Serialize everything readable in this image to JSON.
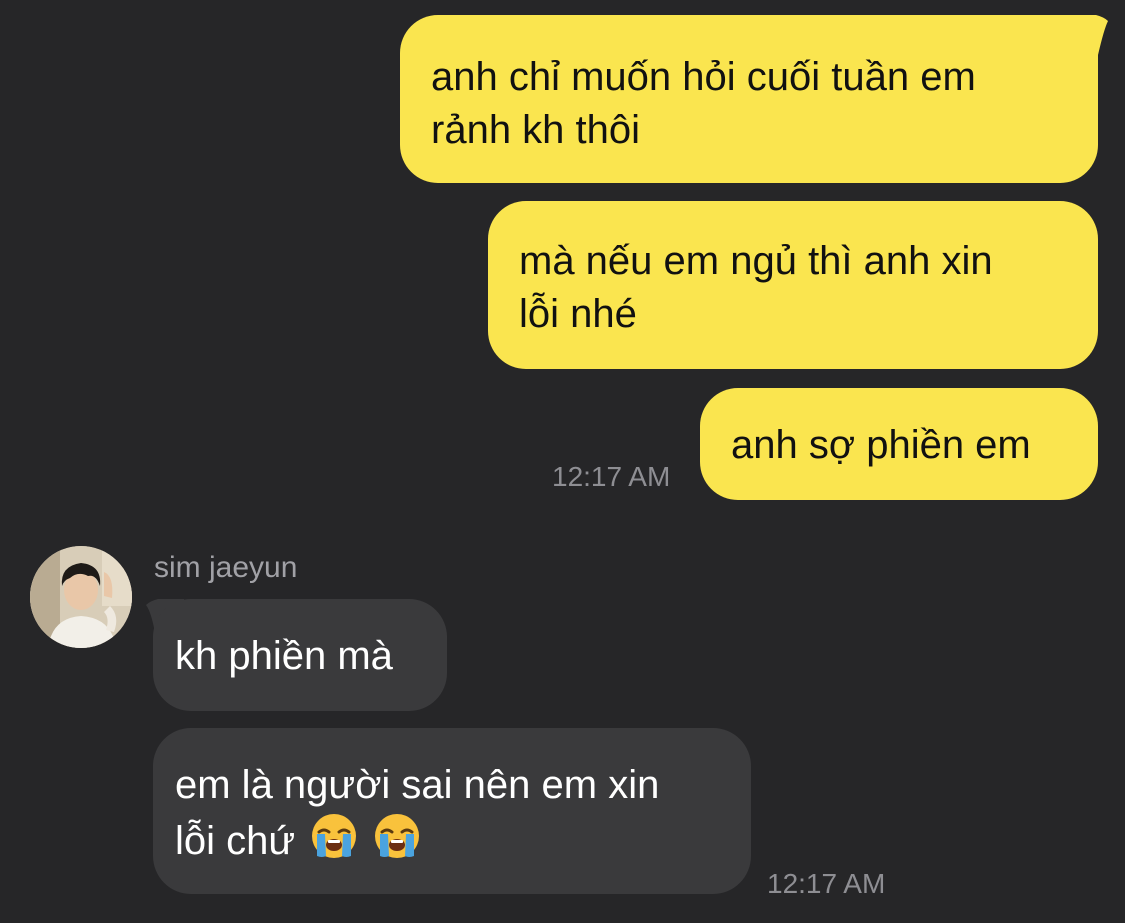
{
  "colors": {
    "background": "#262628",
    "sent_bubble": "#fae54f",
    "received_bubble": "#3a3a3c",
    "timestamp": "#8e8e93"
  },
  "messages": {
    "sent_1": {
      "line1": "anh chỉ muốn hỏi cuối tuần em",
      "line2": "rảnh kh thôi"
    },
    "sent_2": {
      "line1": "mà nếu em ngủ thì anh xin",
      "line2": "lỗi nhé"
    },
    "sent_3": {
      "line1": "anh sợ phiền em"
    },
    "sent_time": "12:17 AM",
    "sender_name": "sim jaeyun",
    "recv_1": {
      "line1": "kh phiền mà"
    },
    "recv_2": {
      "line1": "em là người sai nên em xin",
      "line2": "lỗi chứ",
      "emojis": [
        "loudly-crying-face",
        "loudly-crying-face"
      ]
    },
    "recv_time": "12:17 AM"
  }
}
